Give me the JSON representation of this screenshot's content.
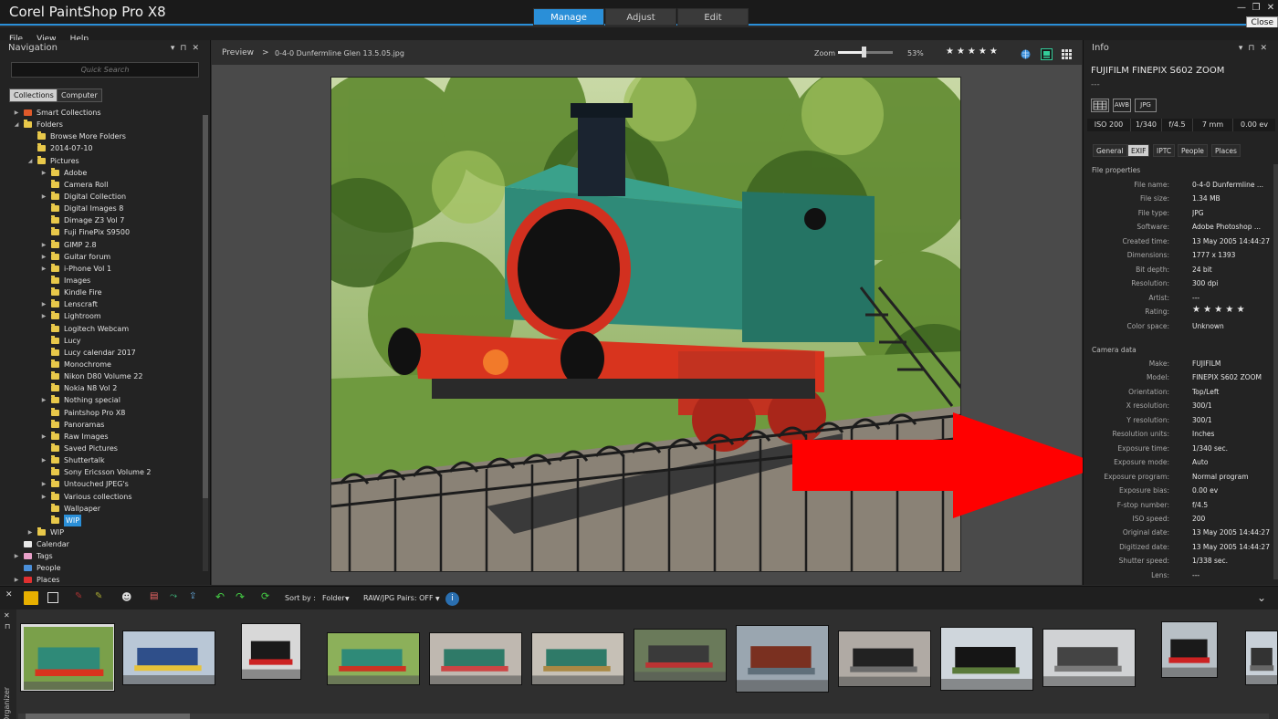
{
  "app": {
    "title": "Corel PaintShop Pro X8",
    "modes": [
      "Manage",
      "Adjust",
      "Edit"
    ],
    "active_mode": "Manage",
    "close_tooltip": "Close",
    "accent_color": "#2a8fd8"
  },
  "menu": [
    "File",
    "View",
    "Help"
  ],
  "navigation": {
    "title": "Navigation",
    "search_placeholder": "Quick Search",
    "tabs": [
      "Collections",
      "Computer"
    ],
    "active_tab": "Collections",
    "tree": [
      {
        "label": "Smart Collections",
        "level": 0,
        "expander": "▶",
        "icon": "smart-collection-icon"
      },
      {
        "label": "Folders",
        "level": 0,
        "expander": "◢",
        "icon": "folder-icon"
      },
      {
        "label": "Browse More Folders",
        "level": 1,
        "expander": "",
        "icon": "folder-icon"
      },
      {
        "label": "2014-07-10",
        "level": 1,
        "expander": "",
        "icon": "folder-icon"
      },
      {
        "label": "Pictures",
        "level": 1,
        "expander": "◢",
        "icon": "folder-icon"
      },
      {
        "label": "Adobe",
        "level": 2,
        "expander": "▶",
        "icon": "folder-icon"
      },
      {
        "label": "Camera Roll",
        "level": 2,
        "expander": "",
        "icon": "folder-icon"
      },
      {
        "label": "Digital Collection",
        "level": 2,
        "expander": "▶",
        "icon": "folder-icon"
      },
      {
        "label": "Digital Images 8",
        "level": 2,
        "expander": "",
        "icon": "folder-icon"
      },
      {
        "label": "Dimage Z3 Vol 7",
        "level": 2,
        "expander": "",
        "icon": "folder-icon"
      },
      {
        "label": "Fuji FinePix S9500",
        "level": 2,
        "expander": "",
        "icon": "folder-icon"
      },
      {
        "label": "GIMP 2.8",
        "level": 2,
        "expander": "▶",
        "icon": "folder-icon"
      },
      {
        "label": "Guitar forum",
        "level": 2,
        "expander": "▶",
        "icon": "folder-icon"
      },
      {
        "label": "i-Phone Vol 1",
        "level": 2,
        "expander": "▶",
        "icon": "folder-icon"
      },
      {
        "label": "Images",
        "level": 2,
        "expander": "",
        "icon": "folder-icon"
      },
      {
        "label": "Kindle Fire",
        "level": 2,
        "expander": "",
        "icon": "folder-icon"
      },
      {
        "label": "Lenscraft",
        "level": 2,
        "expander": "▶",
        "icon": "folder-icon"
      },
      {
        "label": "Lightroom",
        "level": 2,
        "expander": "▶",
        "icon": "folder-icon"
      },
      {
        "label": "Logitech Webcam",
        "level": 2,
        "expander": "",
        "icon": "folder-icon"
      },
      {
        "label": "Lucy",
        "level": 2,
        "expander": "",
        "icon": "folder-icon"
      },
      {
        "label": "Lucy calendar 2017",
        "level": 2,
        "expander": "",
        "icon": "folder-icon"
      },
      {
        "label": "Monochrome",
        "level": 2,
        "expander": "",
        "icon": "folder-icon"
      },
      {
        "label": "Nikon D80 Volume 22",
        "level": 2,
        "expander": "",
        "icon": "folder-icon"
      },
      {
        "label": "Nokia N8 Vol 2",
        "level": 2,
        "expander": "",
        "icon": "folder-icon"
      },
      {
        "label": "Nothing special",
        "level": 2,
        "expander": "▶",
        "icon": "folder-icon"
      },
      {
        "label": "Paintshop Pro X8",
        "level": 2,
        "expander": "",
        "icon": "folder-icon"
      },
      {
        "label": "Panoramas",
        "level": 2,
        "expander": "",
        "icon": "folder-icon"
      },
      {
        "label": "Raw Images",
        "level": 2,
        "expander": "▶",
        "icon": "folder-icon"
      },
      {
        "label": "Saved Pictures",
        "level": 2,
        "expander": "",
        "icon": "folder-icon"
      },
      {
        "label": "Shuttertalk",
        "level": 2,
        "expander": "▶",
        "icon": "folder-icon"
      },
      {
        "label": "Sony Ericsson Volume 2",
        "level": 2,
        "expander": "",
        "icon": "folder-icon"
      },
      {
        "label": "Untouched JPEG's",
        "level": 2,
        "expander": "▶",
        "icon": "folder-icon"
      },
      {
        "label": "Various collections",
        "level": 2,
        "expander": "▶",
        "icon": "folder-icon"
      },
      {
        "label": "Wallpaper",
        "level": 2,
        "expander": "",
        "icon": "folder-icon"
      },
      {
        "label": "WIP",
        "level": 2,
        "expander": "",
        "icon": "folder-icon",
        "selected": true
      },
      {
        "label": "WIP",
        "level": 1,
        "expander": "▶",
        "icon": "folder-icon"
      },
      {
        "label": "Calendar",
        "level": 0,
        "expander": "",
        "icon": "calendar-icon"
      },
      {
        "label": "Tags",
        "level": 0,
        "expander": "▶",
        "icon": "tag-icon"
      },
      {
        "label": "People",
        "level": 0,
        "expander": "",
        "icon": "people-icon"
      },
      {
        "label": "Places",
        "level": 0,
        "expander": "▶",
        "icon": "places-icon"
      }
    ]
  },
  "preview": {
    "label": "Preview",
    "separator": ">",
    "filename": "0-4-0 Dunfermline Glen 13.5.05.jpg",
    "zoom_label": "Zoom",
    "zoom_value": "53%",
    "zoom_fraction": 0.53,
    "rating_stars": "★★★★★"
  },
  "info": {
    "title": "Info",
    "camera": "FUJIFILM FINEPIX S602 ZOOM",
    "camera_sub": "---",
    "badges": [
      "AWB",
      "JPG"
    ],
    "exposure": [
      "ISO 200",
      "1/340",
      "f/4.5",
      "7 mm",
      "0.00 ev"
    ],
    "tabs": [
      "General",
      "EXIF",
      "IPTC",
      "People",
      "Places"
    ],
    "active_tab": "EXIF",
    "file_properties_title": "File properties",
    "file_properties": [
      {
        "k": "File name:",
        "v": "0-4-0 Dunfermline ..."
      },
      {
        "k": "File size:",
        "v": "1.34 MB"
      },
      {
        "k": "File type:",
        "v": "JPG"
      },
      {
        "k": "Software:",
        "v": "Adobe Photoshop ..."
      },
      {
        "k": "Created time:",
        "v": "13 May 2005 14:44:27"
      },
      {
        "k": "Dimensions:",
        "v": "1777 x 1393"
      },
      {
        "k": "Bit depth:",
        "v": "24 bit"
      },
      {
        "k": "Resolution:",
        "v": "300 dpi"
      },
      {
        "k": "Artist:",
        "v": "---"
      },
      {
        "k": "Rating:",
        "v": "★ ★ ★ ★ ★"
      },
      {
        "k": "Color space:",
        "v": "Unknown"
      }
    ],
    "camera_data_title": "Camera data",
    "camera_data": [
      {
        "k": "Make:",
        "v": "FUJIFILM"
      },
      {
        "k": "Model:",
        "v": "FINEPIX S602 ZOOM"
      },
      {
        "k": "Orientation:",
        "v": "Top/Left"
      },
      {
        "k": "X resolution:",
        "v": "300/1"
      },
      {
        "k": "Y resolution:",
        "v": "300/1"
      },
      {
        "k": "Resolution units:",
        "v": "Inches"
      },
      {
        "k": "Exposure time:",
        "v": "1/340 sec."
      },
      {
        "k": "Exposure mode:",
        "v": "Auto"
      },
      {
        "k": "Exposure program:",
        "v": "Normal program"
      },
      {
        "k": "Exposure bias:",
        "v": "0.00 ev"
      },
      {
        "k": "F-stop number:",
        "v": "f/4.5"
      },
      {
        "k": "ISO speed:",
        "v": "200"
      },
      {
        "k": "Original date:",
        "v": "13 May 2005 14:44:27"
      },
      {
        "k": "Digitized date:",
        "v": "13 May 2005 14:44:27"
      },
      {
        "k": "Shutter speed:",
        "v": "1/338 sec."
      },
      {
        "k": "Lens:",
        "v": "---"
      }
    ]
  },
  "organizer": {
    "label": "Organizer",
    "sort_label": "Sort by :",
    "sort_value": "Folder",
    "raw_pairs": "RAW/JPG Pairs: OFF",
    "thumbnails": [
      "green-loco",
      "blue-diesel",
      "black-loco-front",
      "green-loco-side",
      "green-loco-yard",
      "green-loco-yard-2",
      "steam-loco-smoke",
      "forth-bridge",
      "black-loco-shed",
      "black-steam-loco",
      "steam-train-bridge",
      "black-loco-portrait",
      "partial-thumb"
    ]
  }
}
